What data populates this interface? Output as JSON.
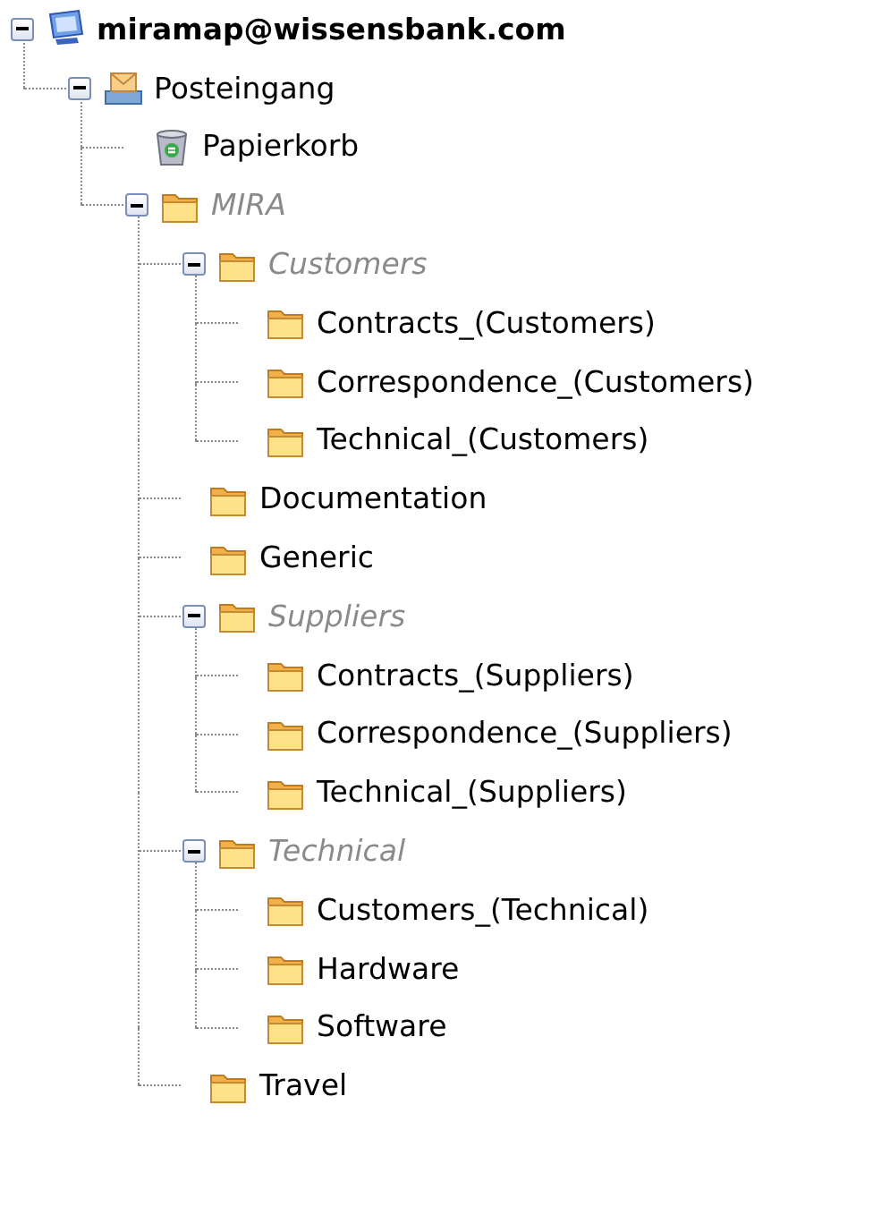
{
  "tree": [
    {
      "label": "miramap@wissensbank.com",
      "kind": "account",
      "dimmed": false,
      "expanded": true,
      "children": [
        {
          "label": "Posteingang",
          "kind": "inbox",
          "dimmed": false,
          "expanded": true,
          "children": [
            {
              "label": "Papierkorb",
              "kind": "trash",
              "dimmed": false
            },
            {
              "label": "MIRA",
              "kind": "folder",
              "dimmed": true,
              "expanded": true,
              "children": [
                {
                  "label": "Customers",
                  "kind": "folder",
                  "dimmed": true,
                  "expanded": true,
                  "children": [
                    {
                      "label": "Contracts_(Customers)",
                      "kind": "folder",
                      "dimmed": false
                    },
                    {
                      "label": "Correspondence_(Customers)",
                      "kind": "folder",
                      "dimmed": false
                    },
                    {
                      "label": "Technical_(Customers)",
                      "kind": "folder",
                      "dimmed": false
                    }
                  ]
                },
                {
                  "label": "Documentation",
                  "kind": "folder",
                  "dimmed": false
                },
                {
                  "label": "Generic",
                  "kind": "folder",
                  "dimmed": false
                },
                {
                  "label": "Suppliers",
                  "kind": "folder",
                  "dimmed": true,
                  "expanded": true,
                  "children": [
                    {
                      "label": "Contracts_(Suppliers)",
                      "kind": "folder",
                      "dimmed": false
                    },
                    {
                      "label": "Correspondence_(Suppliers)",
                      "kind": "folder",
                      "dimmed": false
                    },
                    {
                      "label": "Technical_(Suppliers)",
                      "kind": "folder",
                      "dimmed": false
                    }
                  ]
                },
                {
                  "label": "Technical",
                  "kind": "folder",
                  "dimmed": true,
                  "expanded": true,
                  "children": [
                    {
                      "label": "Customers_(Technical)",
                      "kind": "folder",
                      "dimmed": false
                    },
                    {
                      "label": "Hardware",
                      "kind": "folder",
                      "dimmed": false
                    },
                    {
                      "label": "Software",
                      "kind": "folder",
                      "dimmed": false
                    }
                  ]
                },
                {
                  "label": "Travel",
                  "kind": "folder",
                  "dimmed": false
                }
              ]
            }
          ]
        }
      ]
    }
  ]
}
